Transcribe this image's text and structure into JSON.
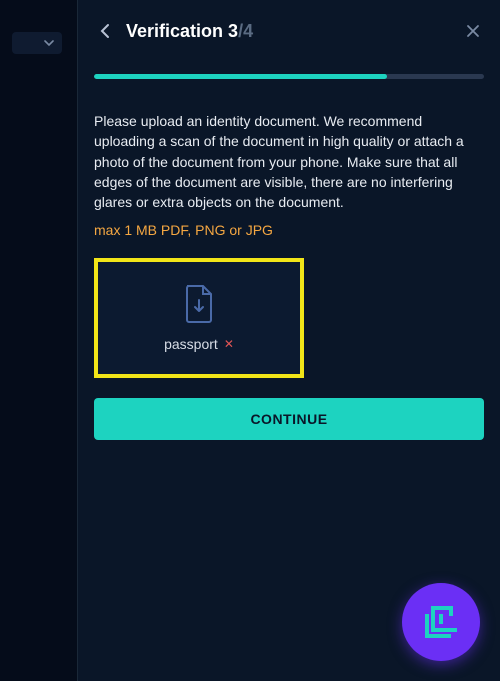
{
  "header": {
    "title_prefix": "Verification ",
    "current_step": "3",
    "separator": "/",
    "total_steps": "4"
  },
  "progress": {
    "percent": 75
  },
  "content": {
    "description": "Please upload an identity document. We recommend uploading a scan of the document in high quality or attach a photo of the document from your phone. Make sure that all edges of the document are visible, there are no interfering glares or extra objects on the document.",
    "file_hint": "max 1 MB PDF, PNG or JPG",
    "uploaded_file_label": "passport"
  },
  "actions": {
    "continue_label": "CONTINUE"
  }
}
